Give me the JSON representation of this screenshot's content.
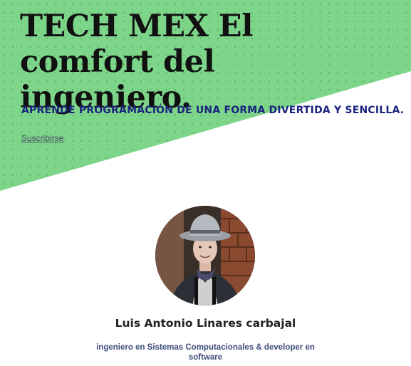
{
  "hero": {
    "title": "TECH MEX El comfort del ingeniero.",
    "subtitle": "APRENDE PROGRAMACIÓN DE UNA FORMA DIVERTIDA Y SENCILLA.",
    "subscribe_label": "Suscribirse"
  },
  "author": {
    "avatar_icon": "author-photo",
    "name": "Luis Antonio Linares carbajal",
    "bio": "ingeniero en Sistemas Computacionales & developer en software"
  },
  "colors": {
    "hero_green": "#7dd589",
    "subtitle_navy": "#1a237e",
    "bio_text": "#3c4b7a",
    "background": "#ffffff"
  }
}
